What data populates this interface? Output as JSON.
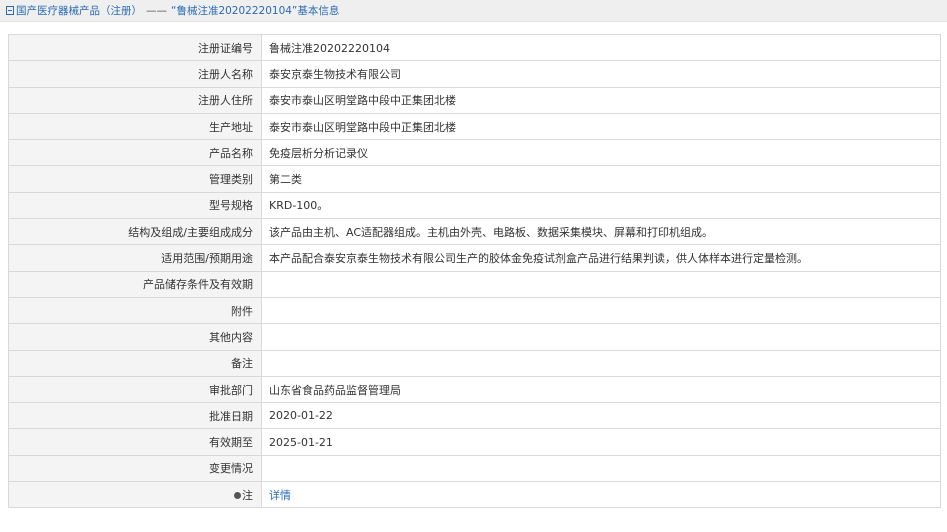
{
  "breadcrumb": {
    "category": "国产医疗器械产品（注册）",
    "separator": "——",
    "current": "“鲁械注准20202220104”基本信息"
  },
  "rows": [
    {
      "label": "注册证编号",
      "value": "鲁械注准20202220104"
    },
    {
      "label": "注册人名称",
      "value": "泰安京泰生物技术有限公司"
    },
    {
      "label": "注册人住所",
      "value": "泰安市泰山区明堂路中段中正集团北楼"
    },
    {
      "label": "生产地址",
      "value": "泰安市泰山区明堂路中段中正集团北楼"
    },
    {
      "label": "产品名称",
      "value": "免疫层析分析记录仪"
    },
    {
      "label": "管理类别",
      "value": "第二类"
    },
    {
      "label": "型号规格",
      "value": "KRD-100。"
    },
    {
      "label": "结构及组成/主要组成成分",
      "value": "该产品由主机、AC适配器组成。主机由外壳、电路板、数据采集模块、屏幕和打印机组成。"
    },
    {
      "label": "适用范围/预期用途",
      "value": "本产品配合泰安京泰生物技术有限公司生产的胶体金免疫试剂盒产品进行结果判读，供人体样本进行定量检测。"
    },
    {
      "label": "产品储存条件及有效期",
      "value": ""
    },
    {
      "label": "附件",
      "value": ""
    },
    {
      "label": "其他内容",
      "value": ""
    },
    {
      "label": "备注",
      "value": ""
    },
    {
      "label": "审批部门",
      "value": "山东省食品药品监督管理局"
    },
    {
      "label": "批准日期",
      "value": "2020-01-22"
    },
    {
      "label": "有效期至",
      "value": "2025-01-21"
    },
    {
      "label": "变更情况",
      "value": ""
    }
  ],
  "note_row": {
    "label": "注",
    "link": "详情"
  }
}
